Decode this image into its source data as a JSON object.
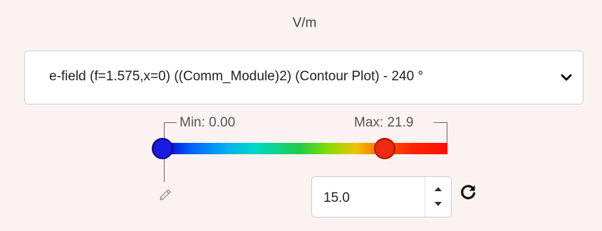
{
  "unit_label": "V/m",
  "plot_select": {
    "selected": "e-field (f=1.575,x=0) ((Comm_Module)2) (Contour Plot) - 240 °"
  },
  "color_range": {
    "min_label": "Min: 0.00",
    "max_label": "Max: 21.9",
    "min_value": 0.0,
    "max_value": 21.9,
    "handle_min_fraction": 0.0,
    "handle_max_fraction": 0.79
  },
  "spin_input": {
    "value": "15.0"
  },
  "icons": {
    "dropdown": "chevron-down-icon",
    "edit": "pencil-icon",
    "refresh": "refresh-icon",
    "spin_up": "caret-up-icon",
    "spin_down": "caret-down-icon"
  },
  "colors": {
    "handle_min": "#1a1ae0",
    "handle_max": "#ee2a10",
    "background": "#fbf3f1"
  }
}
